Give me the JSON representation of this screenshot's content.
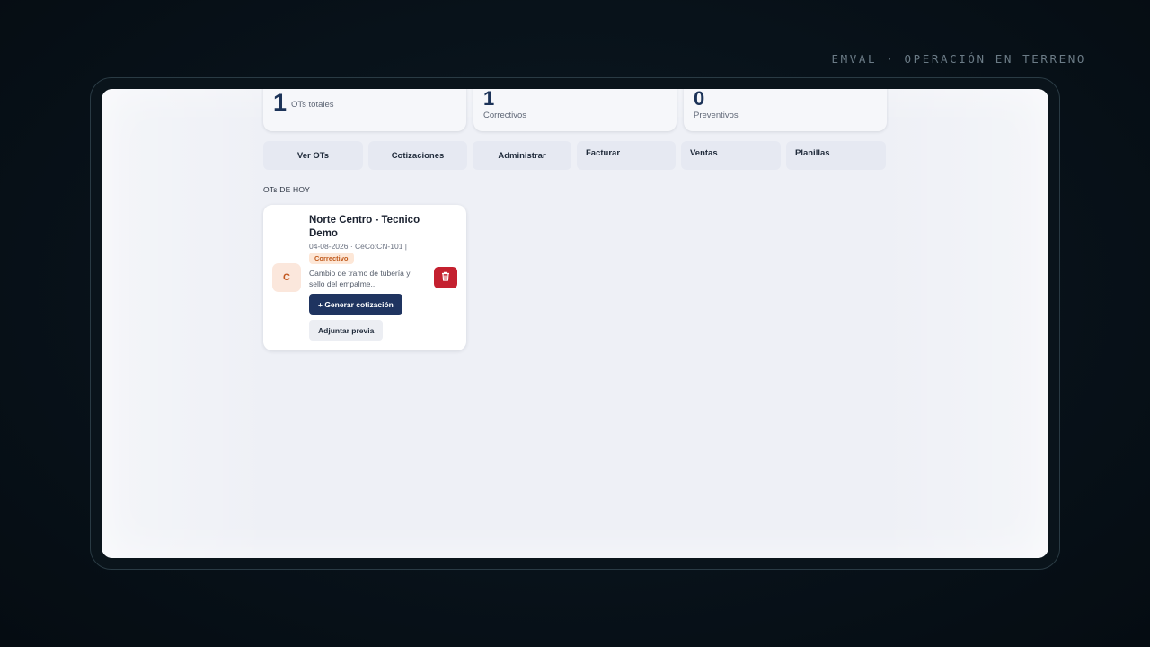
{
  "brand": "EMVAL · OPERACIÓN EN TERRENO",
  "stats": [
    {
      "value": "1",
      "label": "OTs totales"
    },
    {
      "value": "1",
      "label": "Correctivos"
    },
    {
      "value": "0",
      "label": "Preventivos"
    }
  ],
  "nav": {
    "ver_ots": "Ver OTs",
    "cotizaciones": "Cotizaciones",
    "administrar": "Administrar",
    "facturar": "Facturar",
    "ventas": "Ventas",
    "planillas": "Planillas"
  },
  "section_title": "OTs DE HOY",
  "ot_card": {
    "avatar_letter": "C",
    "title": "Norte Centro - Tecnico Demo",
    "meta": "04-08-2026 · CeCo:CN-101 |",
    "badge": "Correctivo",
    "description": "Cambio de tramo de tubería y sello del empalme...",
    "generate_label": "+ Generar cotización",
    "attach_label": "Adjuntar previa",
    "delete_icon": "trash-icon"
  },
  "colors": {
    "accent": "#1f3460",
    "danger": "#c4202f",
    "badge_bg": "#fde7d7",
    "badge_fg": "#c05a1c",
    "background": "#eef0f6"
  }
}
